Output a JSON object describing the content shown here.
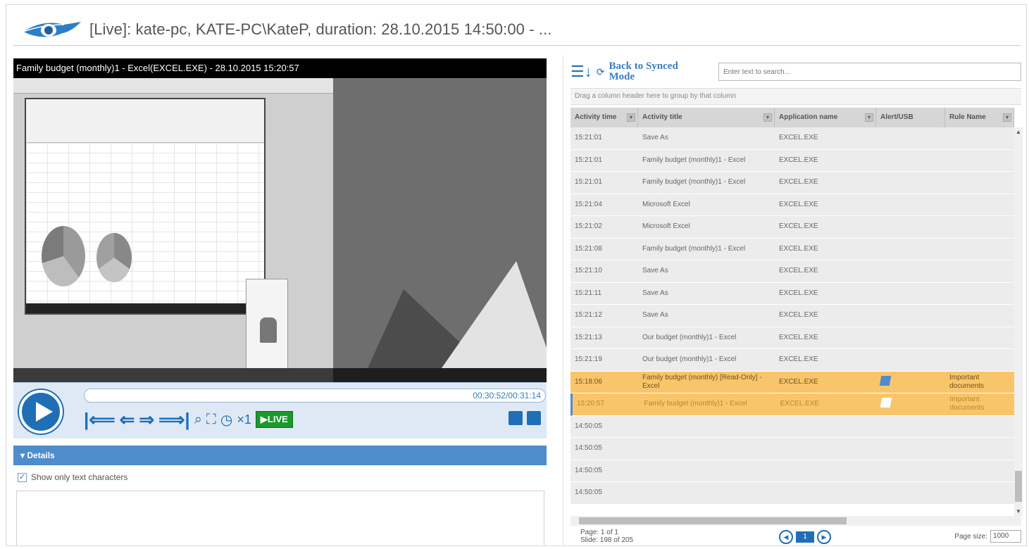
{
  "header": {
    "title": "[Live]: kate-pc, KATE-PC\\KateP, duration: 28.10.2015 14:50:00 - ..."
  },
  "player": {
    "video_title": "Family budget (monthly)1 - Excel(EXCEL.EXE) - 28.10.2015 15:20:57",
    "timecode": "00:30:52/00:31:14",
    "speed": "×1",
    "live_label": "LIVE"
  },
  "details": {
    "header": "Details",
    "checkbox_label": "Show only text characters",
    "checkbox_checked": true
  },
  "right": {
    "back_label": "Back to Synced Mode",
    "search_placeholder": "Enter text to search...",
    "group_hint": "Drag a column header here to group by that column",
    "columns": [
      "Activity time",
      "Activity title",
      "Application name",
      "Alert/USB",
      "Rule Name"
    ],
    "rows": [
      {
        "time": "15:21:01",
        "title": "Save As",
        "app": "EXCEL.EXE",
        "alert": "",
        "rule": ""
      },
      {
        "time": "15:21:01",
        "title": "Family budget (monthly)1 - Excel",
        "app": "EXCEL.EXE",
        "alert": "",
        "rule": ""
      },
      {
        "time": "15:21:01",
        "title": "Family budget (monthly)1 - Excel",
        "app": "EXCEL.EXE",
        "alert": "",
        "rule": ""
      },
      {
        "time": "15:21:04",
        "title": "Microsoft Excel",
        "app": "EXCEL.EXE",
        "alert": "",
        "rule": ""
      },
      {
        "time": "15:21:02",
        "title": "Microsoft Excel",
        "app": "EXCEL.EXE",
        "alert": "",
        "rule": ""
      },
      {
        "time": "15:21:08",
        "title": "Family budget (monthly)1 - Excel",
        "app": "EXCEL.EXE",
        "alert": "",
        "rule": ""
      },
      {
        "time": "15:21:10",
        "title": "Save As",
        "app": "EXCEL.EXE",
        "alert": "",
        "rule": ""
      },
      {
        "time": "15:21:11",
        "title": "Save As",
        "app": "EXCEL.EXE",
        "alert": "",
        "rule": ""
      },
      {
        "time": "15:21:12",
        "title": "Save As",
        "app": "EXCEL.EXE",
        "alert": "",
        "rule": ""
      },
      {
        "time": "15:21:13",
        "title": "Our budget (monthly)1 - Excel",
        "app": "EXCEL.EXE",
        "alert": "",
        "rule": ""
      },
      {
        "time": "15:21:19",
        "title": "Our budget (monthly)1 - Excel",
        "app": "EXCEL.EXE",
        "alert": "",
        "rule": ""
      },
      {
        "time": "15:18:06",
        "title": "Family budget (monthly) [Read-Only] - Excel",
        "app": "EXCEL.EXE",
        "alert": "flag-icon",
        "rule": "Important documents",
        "style": "hl"
      },
      {
        "time": "15:20:57",
        "title": "Family budget (monthly)1 - Excel",
        "app": "EXCEL.EXE",
        "alert": "flag-icon",
        "rule": "Important documents",
        "style": "sel"
      },
      {
        "time": "14:50:05",
        "title": "",
        "app": "",
        "alert": "",
        "rule": ""
      },
      {
        "time": "14:50:05",
        "title": "",
        "app": "",
        "alert": "",
        "rule": ""
      },
      {
        "time": "14:50:05",
        "title": "",
        "app": "",
        "alert": "",
        "rule": ""
      },
      {
        "time": "14:50:05",
        "title": "",
        "app": "",
        "alert": "",
        "rule": ""
      }
    ],
    "pager": {
      "page_info": "Page: 1 of 1",
      "slide_info": "Slide: 198 of 205",
      "current_page": "1",
      "page_size_label": "Page size:",
      "page_size_value": "1000"
    }
  },
  "colors": {
    "accent": "#1f6fb6",
    "highlight_row": "#f9c56a",
    "live": "#1a9a2c",
    "details_header": "#4f8ccc"
  }
}
